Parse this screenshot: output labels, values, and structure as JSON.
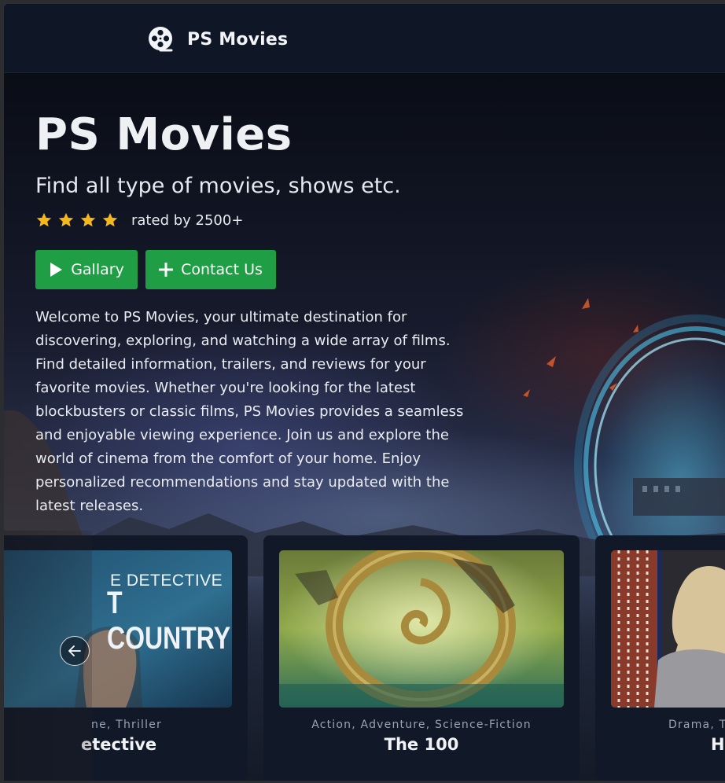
{
  "navbar": {
    "brand": "PS Movies",
    "brand_icon": "film-reel-icon"
  },
  "hero": {
    "title": "PS Movies",
    "subtitle": "Find all type of movies, shows etc.",
    "rating": {
      "stars": 4,
      "text": "rated by 2500+"
    },
    "buttons": {
      "gallery": {
        "label": "Gallary",
        "icon": "play-icon"
      },
      "contact": {
        "label": "Contact Us",
        "icon": "plus-icon"
      }
    },
    "description": "Welcome to PS Movies, your ultimate destination for discovering, exploring, and watching a wide array of films. Find detailed information, trailers, and reviews for your favorite movies. Whether you're looking for the latest blockbusters or classic films, PS Movies provides a seamless and enjoyable viewing experience. Join us and explore the world of cinema from the comfort of your home. Enjoy personalized recommendations and stay updated with the latest releases."
  },
  "carousel": {
    "prev_icon": "arrow-left-icon",
    "cards": [
      {
        "genre": "ne, Thriller",
        "title": "etective",
        "poster_text_1": "E DETECTIVE",
        "poster_text_2": "T COUNTRY"
      },
      {
        "genre": "Action, Adventure, Science-Fiction",
        "title": "The 100"
      },
      {
        "genre": "Drama, T",
        "title": "H"
      }
    ]
  },
  "colors": {
    "accent_green": "#1f9e45",
    "navbar_bg": "#0f1726",
    "card_bg": "#111827",
    "star": "#f5b81a"
  }
}
